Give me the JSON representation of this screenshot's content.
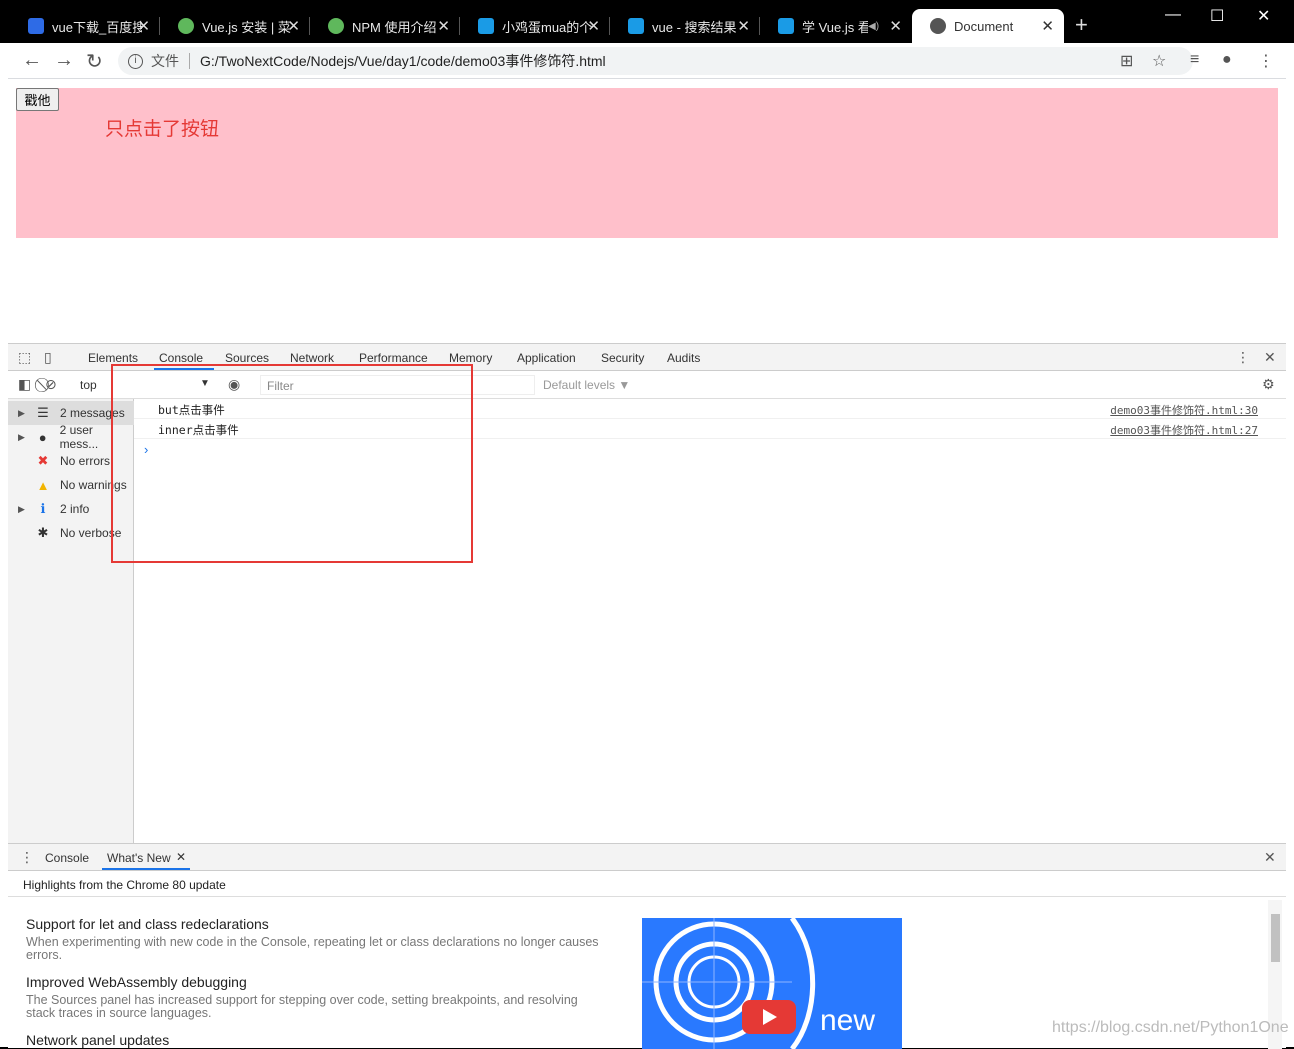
{
  "browser": {
    "tabs": [
      {
        "title": "vue下载_百度搜",
        "favicon_color": "#2e6be6"
      },
      {
        "title": "Vue.js 安装 | 菜",
        "favicon_color": "#5fb85c"
      },
      {
        "title": "NPM 使用介绍",
        "favicon_color": "#5fb85c"
      },
      {
        "title": "小鸡蛋mua的个",
        "favicon_color": "#1a9be6"
      },
      {
        "title": "vue - 搜索结果",
        "favicon_color": "#1a9be6"
      },
      {
        "title": "学 Vue.js 看",
        "favicon_color": "#1a9be6"
      },
      {
        "title": "Document",
        "favicon_color": "#555555"
      }
    ],
    "address": {
      "file_label": "文件",
      "url": "G:/TwoNextCode/Nodejs/Vue/day1/code/demo03事件修饰符.html"
    }
  },
  "page": {
    "button_label": "戳他",
    "message": "只点击了按钮"
  },
  "devtools": {
    "tabs": [
      "Elements",
      "Console",
      "Sources",
      "Network",
      "Performance",
      "Memory",
      "Application",
      "Security",
      "Audits"
    ],
    "context": "top",
    "filter_placeholder": "Filter",
    "levels": "Default levels ▼",
    "sidebar": [
      {
        "label": "2 messages",
        "icon": "list-icon",
        "glyph": "☰",
        "color": "#555"
      },
      {
        "label": "2 user mess...",
        "icon": "user-icon",
        "glyph": "●",
        "color": "#555"
      },
      {
        "label": "No errors",
        "icon": "error-icon",
        "glyph": "✖",
        "color": "#e53935"
      },
      {
        "label": "No warnings",
        "icon": "warning-icon",
        "glyph": "▲",
        "color": "#f2b400"
      },
      {
        "label": "2 info",
        "icon": "info-icon",
        "glyph": "ℹ",
        "color": "#1a73e8"
      },
      {
        "label": "No verbose",
        "icon": "bug-icon",
        "glyph": "✱",
        "color": "#555"
      }
    ],
    "logs": [
      {
        "text": "but点击事件",
        "source": "demo03事件修饰符.html:30"
      },
      {
        "text": "inner点击事件",
        "source": "demo03事件修饰符.html:27"
      }
    ],
    "drawer": {
      "tabs": [
        "Console",
        "What's New"
      ],
      "subtitle": "Highlights from the Chrome 80 update",
      "items": [
        {
          "title": "Support for let and class redeclarations",
          "desc": "When experimenting with new code in the Console, repeating let or class declarations no longer causes errors."
        },
        {
          "title": "Improved WebAssembly debugging",
          "desc": "The Sources panel has increased support for stepping over code, setting breakpoints, and resolving stack traces in source languages."
        },
        {
          "title": "Network panel updates",
          "desc": ""
        }
      ],
      "promo_text": "new"
    }
  },
  "watermark": "https://blog.csdn.net/Python1One"
}
